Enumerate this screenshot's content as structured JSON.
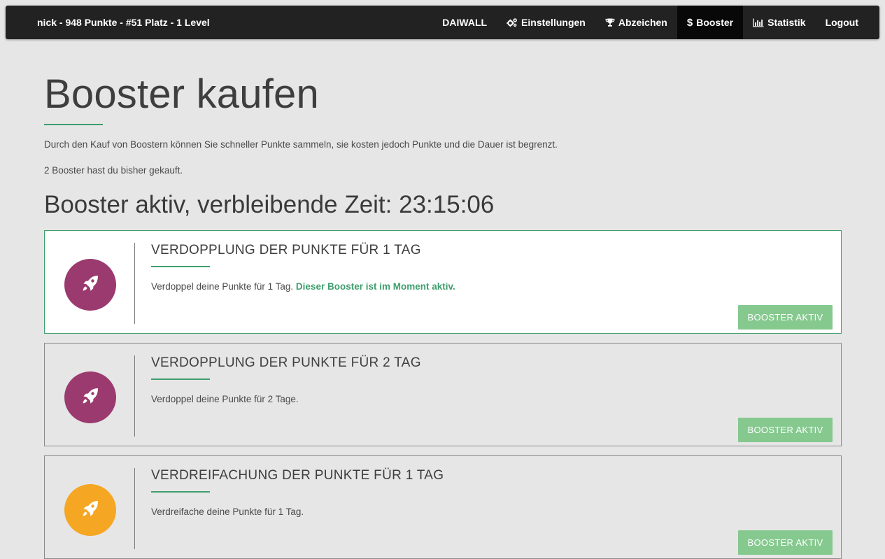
{
  "navbar": {
    "brand": "nick - 948 Punkte - #51 Platz - 1 Level",
    "items": [
      {
        "label": "DAIWALL",
        "icon": null,
        "active": false
      },
      {
        "label": "Einstellungen",
        "icon": "cogs-icon",
        "active": false
      },
      {
        "label": "Abzeichen",
        "icon": "trophy-icon",
        "active": false
      },
      {
        "label": "Booster",
        "icon": "dollar-icon",
        "active": true
      },
      {
        "label": "Statistik",
        "icon": "bar-chart-icon",
        "active": false
      },
      {
        "label": "Logout",
        "icon": null,
        "active": false
      }
    ]
  },
  "page": {
    "title": "Booster kaufen",
    "intro": "Durch den Kauf von Boostern können Sie schneller Punkte sammeln, sie kosten jedoch Punkte und die Dauer ist begrenzt.",
    "count_text": "2 Booster hast du bisher gekauft.",
    "active_status": "Booster aktiv, verbleibende Zeit: 23:15:06"
  },
  "boosters": [
    {
      "title": "VERDOPPLUNG DER PUNKTE FÜR 1 TAG",
      "description": "Verdoppel deine Punkte für 1 Tag.",
      "highlight": "Dieser Booster ist im Moment aktiv.",
      "button": "BOOSTER AKTIV",
      "icon": "rocket-icon",
      "icon_color": "#9b3a6e",
      "active": true
    },
    {
      "title": "VERDOPPLUNG DER PUNKTE FÜR 2 TAG",
      "description": "Verdoppel deine Punkte für 2 Tage.",
      "highlight": "",
      "button": "BOOSTER AKTIV",
      "icon": "rocket-icon",
      "icon_color": "#9b3a6e",
      "active": false
    },
    {
      "title": "VERDREIFACHUNG DER PUNKTE FÜR 1 TAG",
      "description": "Verdreifache deine Punkte für 1 Tag.",
      "highlight": "",
      "button": "BOOSTER AKTIV",
      "icon": "rocket-icon",
      "icon_color": "#f5a623",
      "active": false
    }
  ],
  "colors": {
    "navbar_bg": "#222222",
    "navbar_active": "#080808",
    "accent_green": "#3f9f6d",
    "button_green": "#86c98f",
    "page_bg": "#e6e6e6"
  }
}
